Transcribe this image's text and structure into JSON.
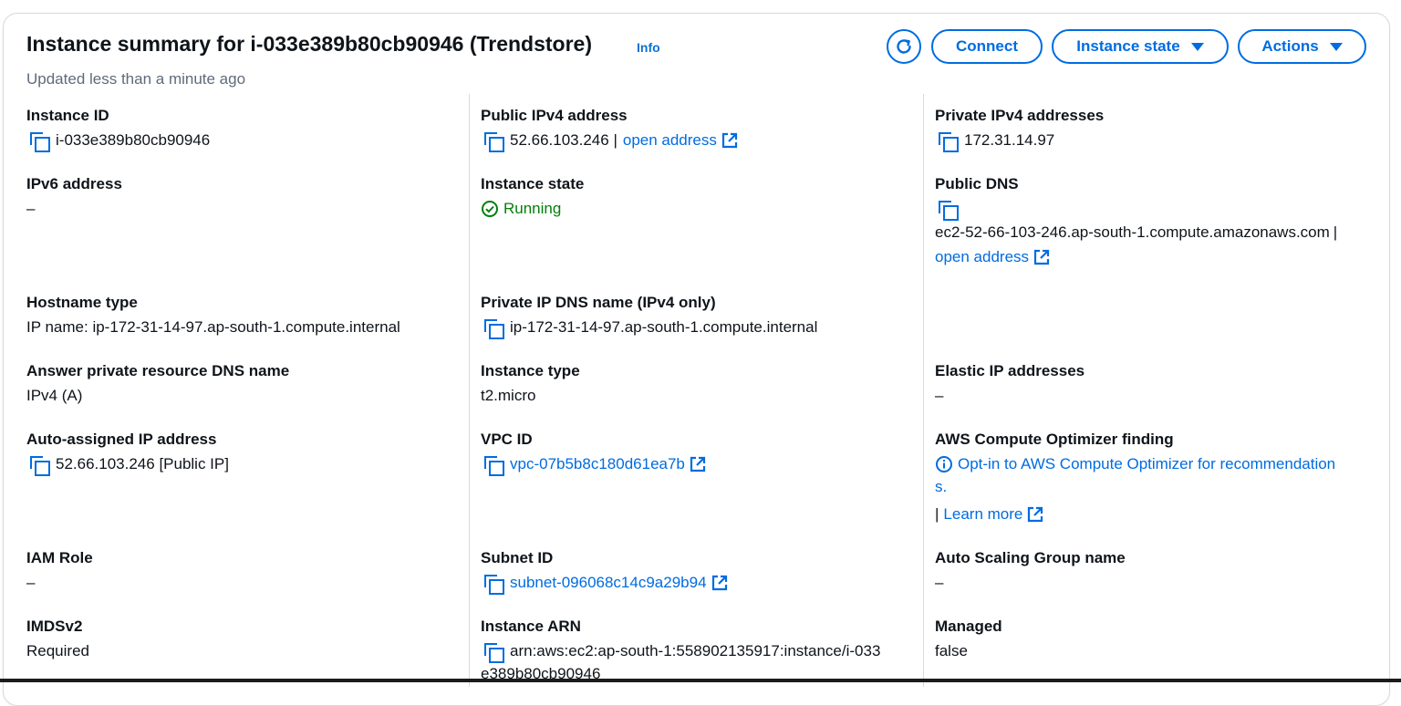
{
  "header": {
    "title": "Instance summary for i-033e389b80cb90946 (Trendstore)",
    "info": "Info",
    "updated": "Updated less than a minute ago",
    "connect": "Connect",
    "instance_state": "Instance state",
    "actions": "Actions"
  },
  "fields": {
    "instance_id": {
      "label": "Instance ID",
      "value": "i-033e389b80cb90946"
    },
    "ipv6": {
      "label": "IPv6 address",
      "value": "–"
    },
    "hostname_type": {
      "label": "Hostname type",
      "value": "IP name: ip-172-31-14-97.ap-south-1.compute.internal"
    },
    "answer_dns": {
      "label": "Answer private resource DNS name",
      "value": "IPv4 (A)"
    },
    "auto_ip": {
      "label": "Auto-assigned IP address",
      "value": "52.66.103.246 [Public IP]"
    },
    "iam_role": {
      "label": "IAM Role",
      "value": "–"
    },
    "imdsv2": {
      "label": "IMDSv2",
      "value": "Required"
    },
    "public_ipv4": {
      "label": "Public IPv4 address",
      "value": "52.66.103.246 |",
      "link": "open address"
    },
    "instance_state": {
      "label": "Instance state",
      "value": "Running"
    },
    "private_dns": {
      "label": "Private IP DNS name (IPv4 only)",
      "value": "ip-172-31-14-97.ap-south-1.compute.internal"
    },
    "instance_type": {
      "label": "Instance type",
      "value": "t2.micro"
    },
    "vpc_id": {
      "label": "VPC ID",
      "value": "vpc-07b5b8c180d61ea7b"
    },
    "subnet_id": {
      "label": "Subnet ID",
      "value": "subnet-096068c14c9a29b94"
    },
    "instance_arn": {
      "label": "Instance ARN",
      "value_line1": "arn:aws:ec2:ap-south-1:558902135917:instance/i-033",
      "value_line2": "e389b80cb90946"
    },
    "private_ipv4": {
      "label": "Private IPv4 addresses",
      "value": "172.31.14.97"
    },
    "public_dns": {
      "label": "Public DNS",
      "value": "ec2-52-66-103-246.ap-south-1.compute.amazonaws.com",
      "sep": "|",
      "link": "open address"
    },
    "elastic_ip": {
      "label": "Elastic IP addresses",
      "value": "–"
    },
    "optimizer": {
      "label": "AWS Compute Optimizer finding",
      "link_line1": "Opt-in to AWS Compute Optimizer for recommendation",
      "link_line2": "s.",
      "sep": "|",
      "learn_more": "Learn more"
    },
    "asg_name": {
      "label": "Auto Scaling Group name",
      "value": "–"
    },
    "managed": {
      "label": "Managed",
      "value": "false"
    }
  },
  "colors": {
    "link": "#006ce0",
    "success": "#037f0c",
    "border": "#d5dbdb"
  },
  "icons": [
    "refresh-icon",
    "copy-icon",
    "external-link-icon",
    "status-success-icon",
    "info-icon",
    "caret-down-icon"
  ]
}
